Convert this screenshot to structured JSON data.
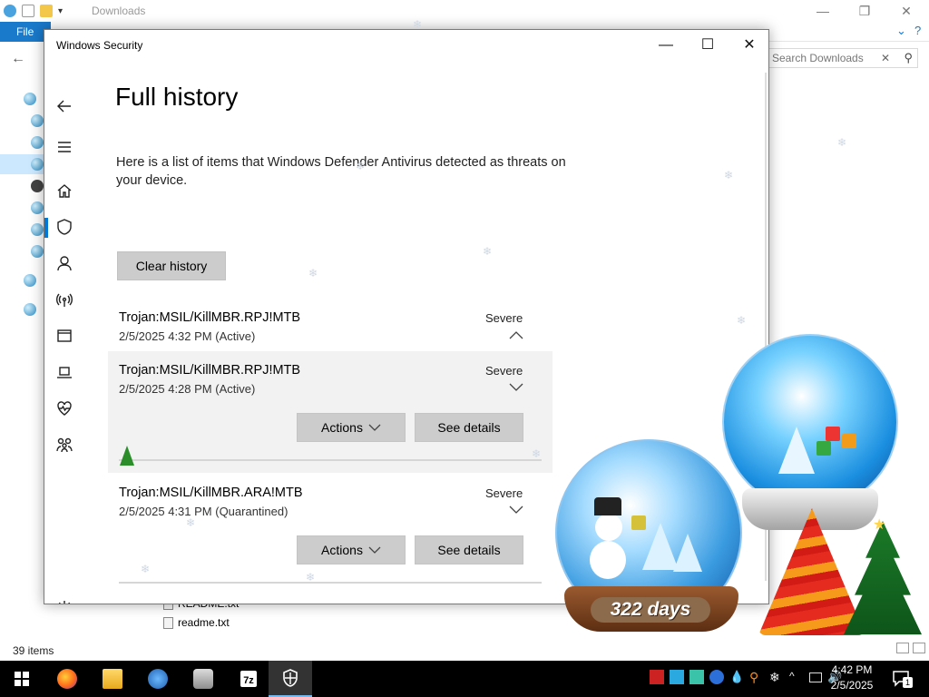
{
  "explorer": {
    "title": "Downloads",
    "file_tab": "File",
    "search_placeholder": "Search Downloads",
    "files": [
      "README.txt",
      "readme.txt"
    ],
    "status": "39 items"
  },
  "window": {
    "title": "Windows Security",
    "controls": {
      "minimize": "—",
      "maximize": "☐",
      "close": "✕"
    }
  },
  "sidebar": {
    "items": [
      {
        "name": "back",
        "icon": "back-arrow-icon"
      },
      {
        "name": "menu",
        "icon": "hamburger-icon"
      },
      {
        "name": "home",
        "icon": "home-icon"
      },
      {
        "name": "virus-protection",
        "icon": "shield-icon"
      },
      {
        "name": "account-protection",
        "icon": "person-icon"
      },
      {
        "name": "firewall",
        "icon": "wireless-icon"
      },
      {
        "name": "app-browser-control",
        "icon": "browser-window-icon"
      },
      {
        "name": "device-security",
        "icon": "laptop-icon"
      },
      {
        "name": "device-performance",
        "icon": "heart-icon"
      },
      {
        "name": "family-options",
        "icon": "family-icon"
      },
      {
        "name": "settings",
        "icon": "gear-icon"
      }
    ]
  },
  "main": {
    "title": "Full history",
    "description": "Here is a list of items that Windows Defender Antivirus detected as threats on your device.",
    "clear_button": "Clear history",
    "threats": [
      {
        "name": "Trojan:MSIL/KillMBR.RPJ!MTB",
        "date": "2/5/2025 4:32 PM (Active)",
        "severity": "Severe",
        "expanded": false
      },
      {
        "name": "Trojan:MSIL/KillMBR.RPJ!MTB",
        "date": "2/5/2025 4:28 PM (Active)",
        "severity": "Severe",
        "expanded": true,
        "actions_label": "Actions",
        "details_label": "See details"
      },
      {
        "name": "Trojan:MSIL/KillMBR.ARA!MTB",
        "date": "2/5/2025 4:31 PM (Quarantined)",
        "severity": "Severe",
        "expanded": true,
        "actions_label": "Actions",
        "details_label": "See details"
      }
    ]
  },
  "decoration": {
    "globe_label": "322 days"
  },
  "taskbar": {
    "apps": [
      "firefox-icon",
      "file-explorer-icon",
      "app-icon",
      "folder-icon",
      "7zip-icon",
      "windows-security-icon"
    ],
    "time": "4:42 PM",
    "date": "2/5/2025",
    "notification_count": "1",
    "accent": "#76b9ed"
  }
}
